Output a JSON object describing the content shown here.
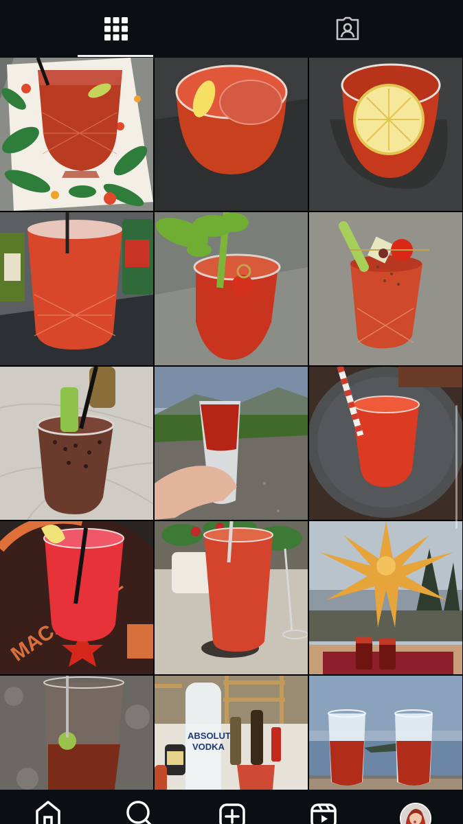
{
  "tabs": [
    {
      "icon": "grid-icon",
      "selected": true
    },
    {
      "icon": "tagged-person-icon",
      "selected": false
    }
  ],
  "bottom_nav": [
    {
      "icon": "home-icon"
    },
    {
      "icon": "search-icon"
    },
    {
      "icon": "new-post-icon"
    },
    {
      "icon": "reels-icon"
    },
    {
      "icon": "profile-avatar"
    }
  ],
  "posts": [
    {
      "subject": "bloody-mary-crystal-glass-tropical-runner"
    },
    {
      "subject": "bloody-mary-lemon-tumbler"
    },
    {
      "subject": "bloody-mary-lemon-slice-top"
    },
    {
      "subject": "bloody-mary-tall-glass-tabasco-beer"
    },
    {
      "subject": "bloody-mary-celery-tomato"
    },
    {
      "subject": "bloody-mary-celery-garnish-skewer"
    },
    {
      "subject": "bloody-mary-celery-straw-marble"
    },
    {
      "subject": "bloody-mary-layered-glass-landscape"
    },
    {
      "subject": "bloody-mary-striped-straw"
    },
    {
      "subject": "bloody-mary-macardell-table"
    },
    {
      "subject": "bloody-mary-pint-glass-coaster"
    },
    {
      "subject": "bloody-mary-two-glasses-star-lantern"
    },
    {
      "subject": "bloody-mary-spoon-granite"
    },
    {
      "subject": "bloody-mary-absolut-vodka-bottle"
    },
    {
      "subject": "bloody-mary-two-glasses-sea-view"
    }
  ],
  "photo_text": {
    "vodka_brand": "ABSOLUT",
    "vodka_type": "VODKA",
    "table_print": "MACARDELL"
  },
  "colors": {
    "bar_background": "#0b0f14",
    "icon": "#ffffff",
    "tab_icon_inactive": "#c8c8c8",
    "drink_red": "#c8321e"
  }
}
